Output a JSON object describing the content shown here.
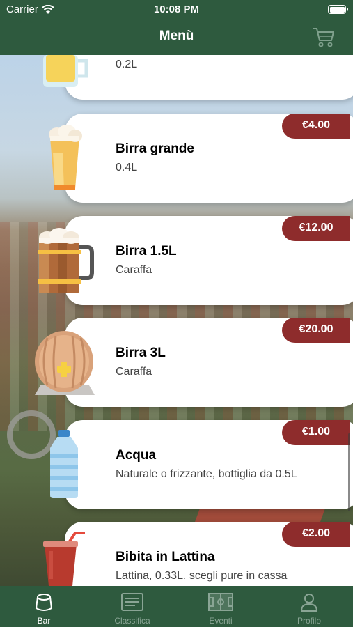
{
  "status_bar": {
    "carrier": "Carrier",
    "time": "10:08 PM"
  },
  "nav": {
    "title": "Menù"
  },
  "items": [
    {
      "name": "",
      "desc": "0.2L",
      "price": "",
      "icon": "small-beer-icon"
    },
    {
      "name": "Birra grande",
      "desc": "0.4L",
      "price": "€4.00",
      "icon": "tall-beer-glass-icon"
    },
    {
      "name": "Birra 1.5L",
      "desc": "Caraffa",
      "price": "€12.00",
      "icon": "beer-mug-icon"
    },
    {
      "name": "Birra 3L",
      "desc": "Caraffa",
      "price": "€20.00",
      "icon": "beer-barrel-icon"
    },
    {
      "name": "Acqua",
      "desc": "Naturale o frizzante, bottiglia da 0.5L",
      "price": "€1.00",
      "icon": "water-bottle-icon"
    },
    {
      "name": "Bibita in Lattina",
      "desc": "Lattina, 0.33L, scegli pure in cassa",
      "price": "€2.00",
      "icon": "soda-cup-icon"
    }
  ],
  "tabs": [
    {
      "label": "Bar",
      "active": true
    },
    {
      "label": "Classifica",
      "active": false
    },
    {
      "label": "Eventi",
      "active": false
    },
    {
      "label": "Profilo",
      "active": false
    }
  ],
  "colors": {
    "bar_green": "#2e5a3e",
    "price_red": "#8e2c2c",
    "inactive_tab": "#8aa595"
  }
}
